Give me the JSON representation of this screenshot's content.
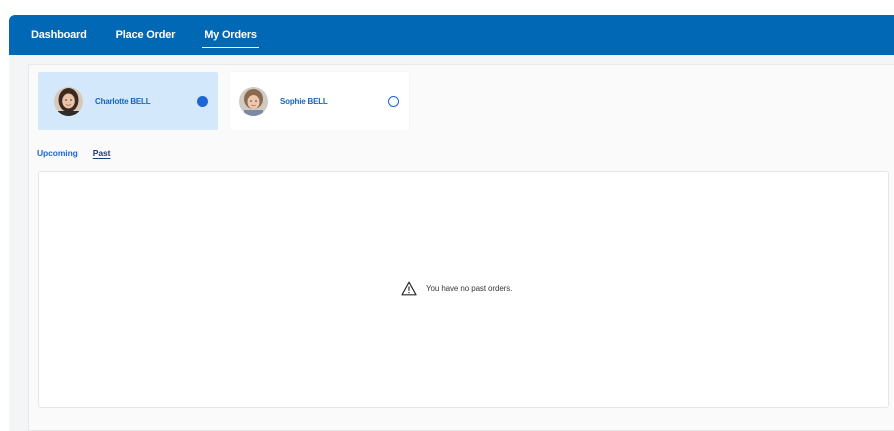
{
  "nav": {
    "items": [
      {
        "label": "Dashboard",
        "active": false
      },
      {
        "label": "Place Order",
        "active": false
      },
      {
        "label": "My Orders",
        "active": true
      }
    ],
    "background": "#0068b4"
  },
  "children": [
    {
      "name": "Charlotte BELL",
      "selected": true,
      "avatar_icon": "person-photo-icon"
    },
    {
      "name": "Sophie BELL",
      "selected": false,
      "avatar_icon": "person-photo-icon"
    }
  ],
  "tabs": [
    {
      "label": "Upcoming",
      "active": false
    },
    {
      "label": "Past",
      "active": true
    }
  ],
  "empty_state": {
    "icon": "warning-icon",
    "message": "You have no past orders."
  },
  "colors": {
    "accent": "#1e66d6",
    "selected_card": "#d4e8fb"
  }
}
